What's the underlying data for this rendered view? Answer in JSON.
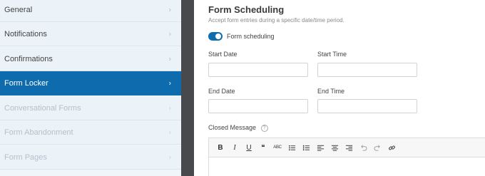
{
  "sidebar": {
    "items": [
      {
        "label": "General",
        "state": "normal"
      },
      {
        "label": "Notifications",
        "state": "normal"
      },
      {
        "label": "Confirmations",
        "state": "normal"
      },
      {
        "label": "Form Locker",
        "state": "active"
      },
      {
        "label": "Conversational Forms",
        "state": "disabled"
      },
      {
        "label": "Form Abandonment",
        "state": "disabled"
      },
      {
        "label": "Form Pages",
        "state": "disabled"
      }
    ],
    "chevron": "›"
  },
  "section": {
    "title": "Form Scheduling",
    "description": "Accept form entries during a specific date/time period."
  },
  "toggle": {
    "label": "Form scheduling",
    "on": true
  },
  "fields": {
    "start_date_label": "Start Date",
    "start_time_label": "Start Time",
    "end_date_label": "End Date",
    "end_time_label": "End Time",
    "closed_message_label": "Closed Message",
    "help_glyph": "?"
  },
  "editor": {
    "toolbar": [
      "bold",
      "italic",
      "underline",
      "blockquote",
      "strikethrough",
      "bullet-list",
      "numbered-list",
      "align-left",
      "align-center",
      "align-right",
      "undo",
      "redo",
      "link"
    ],
    "bold_glyph": "B",
    "italic_glyph": "I",
    "underline_glyph": "U",
    "quote_glyph": "❝",
    "strike_glyph": "ABC"
  },
  "colors": {
    "accent": "#0e6bad",
    "sidebar_bg": "#ebf2f8",
    "divider": "#47494c"
  }
}
